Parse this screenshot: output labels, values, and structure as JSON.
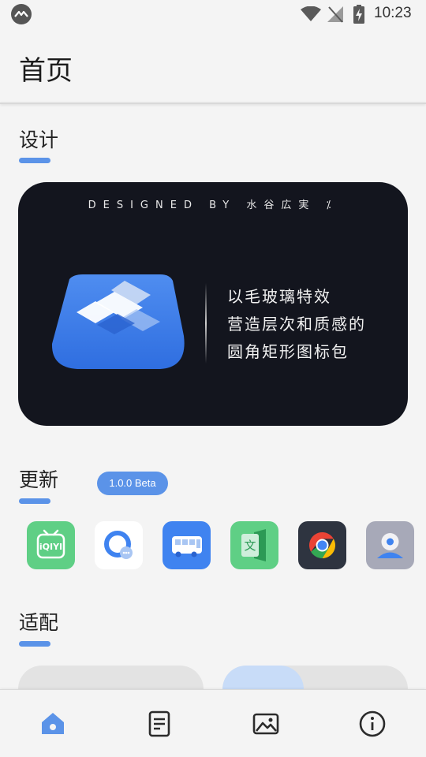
{
  "status_bar": {
    "time": "10:23",
    "icons": [
      "app-notification-icon",
      "wifi-icon",
      "no-signal-icon",
      "battery-charging-icon"
    ]
  },
  "header": {
    "title": "首页"
  },
  "sections": {
    "design": {
      "title": "设计",
      "banner": {
        "credit": "DESIGNED BY 水谷広実 ⁒",
        "lines": [
          "以毛玻璃特效",
          "营造层次和质感的",
          "圆角矩形图标包"
        ]
      }
    },
    "update": {
      "title": "更新",
      "version_badge": "1.0.0 Beta",
      "apps": [
        {
          "name": "iqiyi-app-icon",
          "color": "#5fcf85"
        },
        {
          "name": "qq-browser-app-icon",
          "color": "#ffffff"
        },
        {
          "name": "bus-app-icon",
          "color": "#3f83f0"
        },
        {
          "name": "wps-excel-app-icon",
          "color": "#5fcf85"
        },
        {
          "name": "chrome-app-icon",
          "color": "#2e3440"
        },
        {
          "name": "contact-app-icon",
          "color": "#a7a9b8"
        }
      ]
    },
    "adapt": {
      "title": "适配"
    }
  },
  "bottom_nav": {
    "items": [
      "home-icon",
      "document-icon",
      "image-icon",
      "info-icon"
    ],
    "active": "home-icon"
  },
  "colors": {
    "accent": "#5b93e8",
    "background": "#f4f4f4",
    "banner_bg": "#13151e"
  }
}
